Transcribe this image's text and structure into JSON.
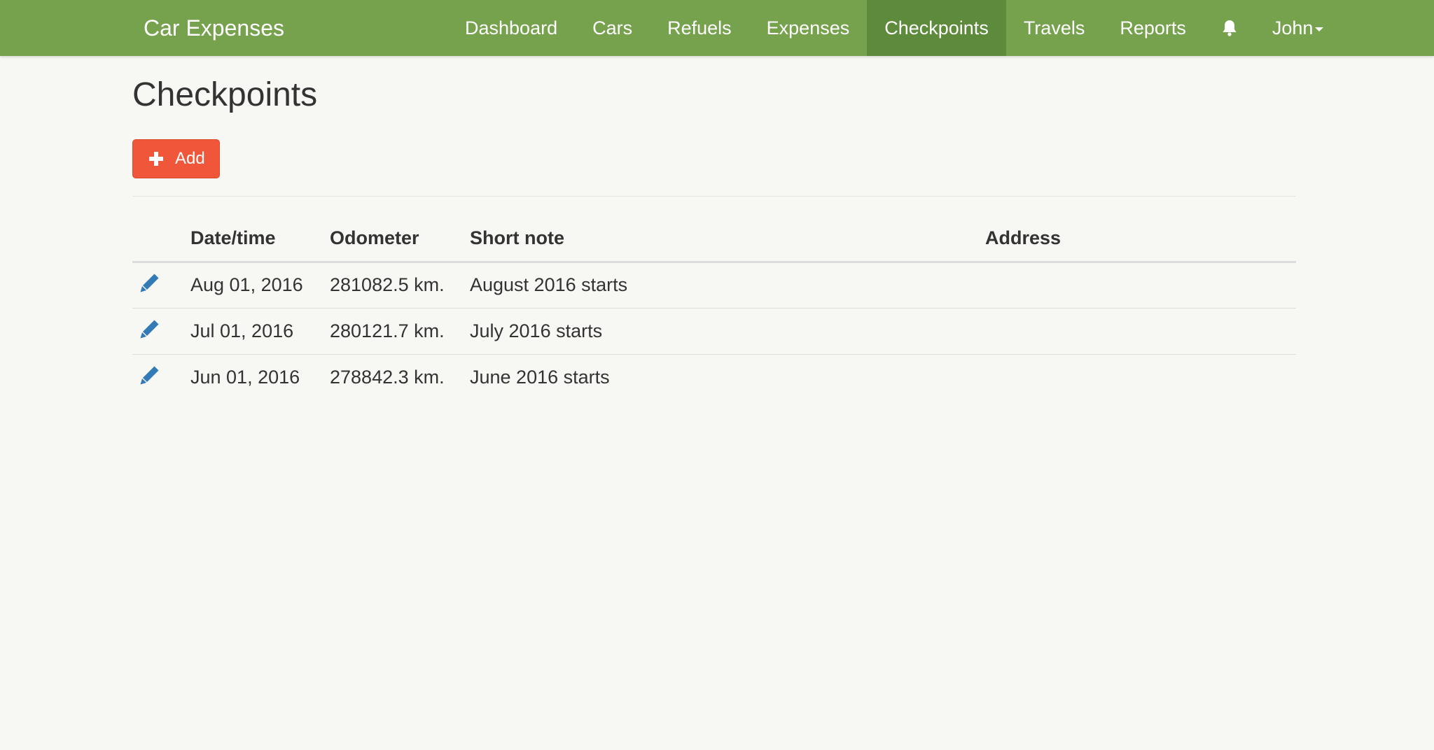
{
  "app": {
    "brand": "Car Expenses"
  },
  "nav": {
    "items": [
      {
        "label": "Dashboard",
        "active": false
      },
      {
        "label": "Cars",
        "active": false
      },
      {
        "label": "Refuels",
        "active": false
      },
      {
        "label": "Expenses",
        "active": false
      },
      {
        "label": "Checkpoints",
        "active": true
      },
      {
        "label": "Travels",
        "active": false
      },
      {
        "label": "Reports",
        "active": false
      }
    ],
    "notifications_icon": "bell-icon",
    "user": "John"
  },
  "page": {
    "title": "Checkpoints",
    "add_label": "Add",
    "add_icon": "plus-icon"
  },
  "table": {
    "headers": {
      "date": "Date/time",
      "odometer": "Odometer",
      "note": "Short note",
      "address": "Address"
    },
    "rows": [
      {
        "date": "Aug 01, 2016",
        "odometer": "281082.5 km.",
        "note": "August 2016 starts",
        "address": ""
      },
      {
        "date": "Jul 01, 2016",
        "odometer": "280121.7 km.",
        "note": "July 2016 starts",
        "address": ""
      },
      {
        "date": "Jun 01, 2016",
        "odometer": "278842.3 km.",
        "note": "June 2016 starts",
        "address": ""
      }
    ],
    "edit_icon": "pencil-icon"
  },
  "colors": {
    "navbar": "#77a24d",
    "navbar_active": "#5d8a3b",
    "add_button": "#f0573a",
    "edit_icon": "#337ab7",
    "background": "#f7f8f4"
  }
}
